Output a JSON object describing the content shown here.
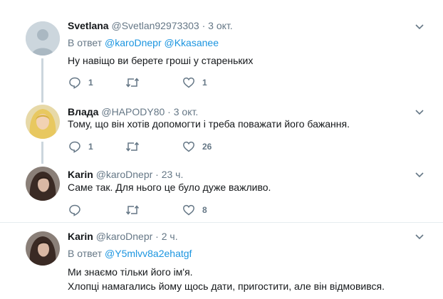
{
  "tweets": [
    {
      "name": "Svetlana",
      "handle": "@Svetlan92973303",
      "sep": "·",
      "time": "3 окт.",
      "reply_prefix": "В ответ",
      "reply_mentions": [
        "@karoDnepr",
        "@Kkasanee"
      ],
      "text_lines": [
        "Ну навіщо ви берете гроші у старенькиx"
      ],
      "replies": "1",
      "retweets": "",
      "likes": "1",
      "avatar": "default-avatar"
    },
    {
      "name": "Влада",
      "handle": "@HAPODY80",
      "sep": "·",
      "time": "3 окт.",
      "text_lines": [
        "Тому, що він хотів допомогти і треба поважати його бажання."
      ],
      "replies": "1",
      "retweets": "",
      "likes": "26",
      "avatar": "blonde-woman-avatar"
    },
    {
      "name": "Karin",
      "handle": "@karoDnepr",
      "sep": "·",
      "time": "23 ч.",
      "text_lines": [
        "Саме так. Для нього це було дуже важливо."
      ],
      "replies": "",
      "retweets": "",
      "likes": "8",
      "avatar": "dark-hair-woman-avatar"
    },
    {
      "name": "Karin",
      "handle": "@karoDnepr",
      "sep": "·",
      "time": "2 ч.",
      "reply_prefix": "В ответ",
      "reply_mentions": [
        "@Y5mlvv8a2ehatgf"
      ],
      "text_lines": [
        "Ми знаємо тільки його ім'я.",
        "Хлопці намагались йому щось дати, пригостити, але він відмовився."
      ],
      "avatar": "dark-hair-woman-avatar"
    }
  ],
  "colors": {
    "accent": "#1b95e0",
    "secondary_text": "#657786",
    "thread_line": "#ccd6dd",
    "divider": "#e6ecf0"
  }
}
